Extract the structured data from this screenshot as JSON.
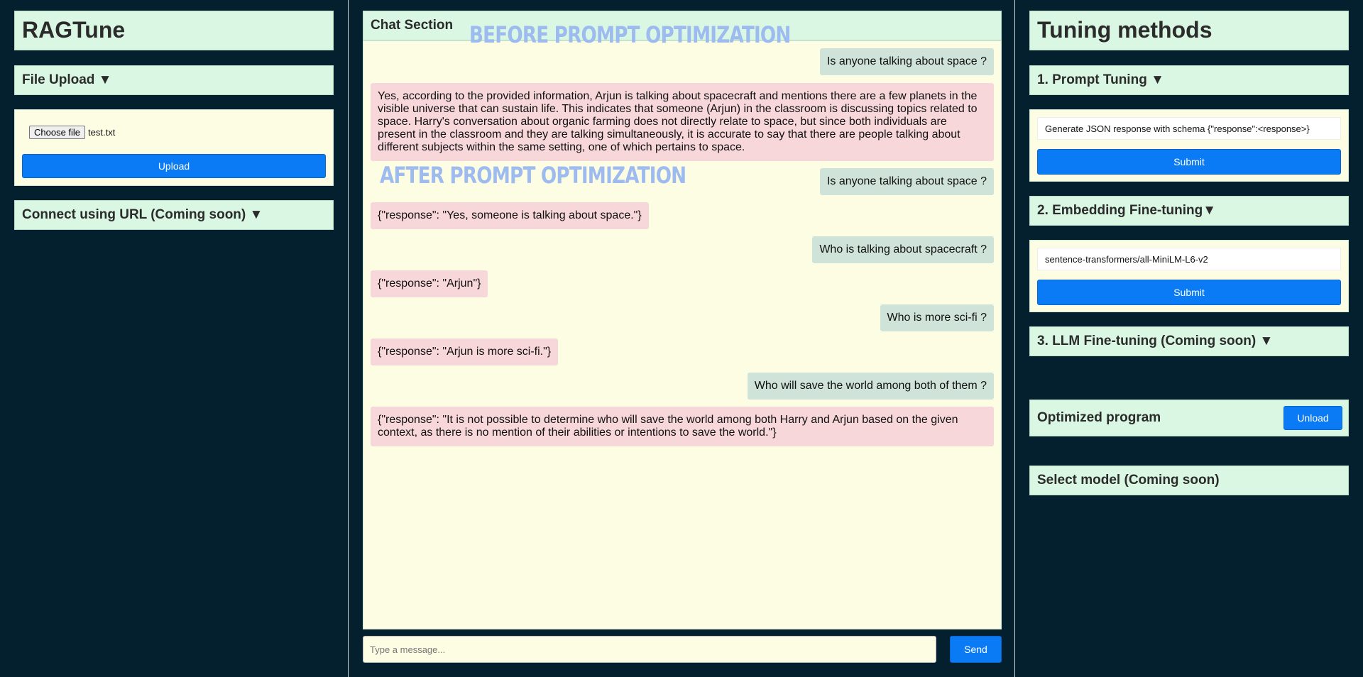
{
  "left": {
    "app_title": "RAGTune",
    "file_upload_header": "File Upload ▼",
    "choose_file_label": "Choose file",
    "file_name": "test.txt",
    "upload_label": "Upload",
    "connect_url_header": "Connect using URL (Coming soon) ▼"
  },
  "chat": {
    "title": "Chat Section",
    "label_before": "BEFORE PROMPT OPTIMIZATION",
    "label_after": "AFTER PROMPT OPTIMIZATION",
    "messages": [
      {
        "role": "user",
        "text": "Is anyone talking about space ?"
      },
      {
        "role": "bot",
        "text": "Yes, according to the provided information, Arjun is talking about spacecraft and mentions there are a few planets in the visible universe that can sustain life. This indicates that someone (Arjun) in the classroom is discussing topics related to space. Harry's conversation about organic farming does not directly relate to space, but since both individuals are present in the classroom and they are talking simultaneously, it is accurate to say that there are people talking about different subjects within the same setting, one of which pertains to space."
      },
      {
        "role": "user",
        "text": "Is anyone talking about space ?"
      },
      {
        "role": "bot",
        "text": "{\"response\": \"Yes, someone is talking about space.\"}"
      },
      {
        "role": "user",
        "text": "Who is talking about spacecraft ?"
      },
      {
        "role": "bot",
        "text": "{\"response\": \"Arjun\"}"
      },
      {
        "role": "user",
        "text": "Who is more sci-fi ?"
      },
      {
        "role": "bot",
        "text": "{\"response\": \"Arjun is more sci-fi.\"}"
      },
      {
        "role": "user",
        "text": "Who will save the world among both of them ?"
      },
      {
        "role": "bot",
        "text": "{\"response\": \"It is not possible to determine who will save the world among both Harry and Arjun based on the given context, as there is no mention of their abilities or intentions to save the world.\"}"
      }
    ],
    "input_placeholder": "Type a message...",
    "send_label": "Send"
  },
  "right": {
    "title": "Tuning methods",
    "prompt_tuning_header": "1. Prompt Tuning ▼",
    "prompt_value": "Generate JSON response with schema {\"response\":<response>}",
    "prompt_submit": "Submit",
    "embedding_header": "2. Embedding Fine-tuning▼",
    "embedding_value": "sentence-transformers/all-MiniLM-L6-v2",
    "embedding_submit": "Submit",
    "llm_header": "3. LLM Fine-tuning (Coming soon) ▼",
    "optimized_label": "Optimized program",
    "unload_label": "Unload",
    "select_model_label": "Select model (Coming soon)"
  }
}
